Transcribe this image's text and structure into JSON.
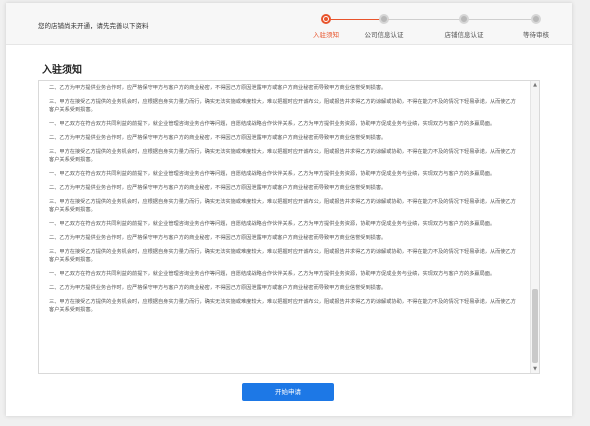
{
  "topbar": {
    "notice": "您的店铺尚未开通，请先完善以下资料"
  },
  "steps": [
    {
      "label": "入驻须知",
      "active": true
    },
    {
      "label": "公司信息认证",
      "active": false
    },
    {
      "label": "店铺信息认证",
      "active": false
    },
    {
      "label": "等待审核",
      "active": false
    }
  ],
  "main": {
    "title": "入驻须知",
    "paragraphs": [
      "二、乙方为甲方提供业务合作时，应严格保守甲方与客户方的商业秘密，不得因己方原因泄露甲方或客户方商业秘密而导致甲方商业信誉受到损害。",
      "三、甲方在接受乙方提供的业务机会时，应根据自身实力量力而行，确实无法实施或难度较大，难以把握时应开诚布公，阻或报告并求得乙方的谅解或协助，不得在能力不及的情况下轻易承诺，从而使乙方客户关系受到损害。",
      "一、甲乙双方在符合双方共同利益的前提下，就企业管理咨询业务合作等问题，自愿结成战略合作伙伴关系，乙方为甲方提供业务资源，协助甲方促成业务与业绩，实现双方与客户方的多赢局面。",
      "二、乙方为甲方提供业务合作时，应严格保守甲方与客户方的商业秘密，不得因己方原因泄露甲方或客户方商业秘密而导致甲方商业信誉受到损害。",
      "三、甲方在接受乙方提供的业务机会时，应根据自身实力量力而行，确实无法实施或难度较大，难以把握时应开诚布公，阻或报告并求得乙方的谅解或协助，不得在能力不及的情况下轻易承诺，从而使乙方客户关系受到损害。",
      "一、甲乙双方在符合双方共同利益的前提下，就企业管理咨询业务合作等问题，自愿结成战略合作伙伴关系，乙方为甲方提供业务资源，协助甲方促成业务与业绩，实现双方与客户方的多赢局面。",
      "二、乙方为甲方提供业务合作时，应严格保守甲方与客户方的商业秘密，不得因己方原因泄露甲方或客户方商业秘密而导致甲方商业信誉受到损害。",
      "三、甲方在接受乙方提供的业务机会时，应根据自身实力量力而行，确实无法实施或难度较大，难以把握时应开诚布公，阻或报告并求得乙方的谅解或协助，不得在能力不及的情况下轻易承诺，从而使乙方客户关系受到损害。",
      "一、甲乙双方在符合双方共同利益的前提下，就企业管理咨询业务合作等问题，自愿结成战略合作伙伴关系，乙方为甲方提供业务资源，协助甲方促成业务与业绩，实现双方与客户方的多赢局面。",
      "二、乙方为甲方提供业务合作时，应严格保守甲方与客户方的商业秘密，不得因己方原因泄露甲方或客户方商业秘密而导致甲方商业信誉受到损害。",
      "三、甲方在接受乙方提供的业务机会时，应根据自身实力量力而行，确实无法实施或难度较大，难以把握时应开诚布公，阻或报告并求得乙方的谅解或协助，不得在能力不及的情况下轻易承诺，从而使乙方客户关系受到损害。",
      "一、甲乙双方在符合双方共同利益的前提下，就企业管理咨询业务合作等问题，自愿结成战略合作伙伴关系，乙方为甲方提供业务资源，协助甲方促成业务与业绩，实现双方与客户方的多赢局面。",
      "二、乙方为甲方提供业务合作时，应严格保守甲方与客户方的商业秘密，不得因己方原因泄露甲方或客户方商业秘密而导致甲方商业信誉受到损害。",
      "三、甲方在接受乙方提供的业务机会时，应根据自身实力量力而行，确实无法实施或难度较大，难以把握时应开诚布公，阻或报告并求得乙方的谅解或协助，不得在能力不及的情况下轻易承诺，从而使乙方客户关系受到损害。"
    ],
    "submit_label": "开始申请"
  },
  "colors": {
    "accent": "#e8542c",
    "primary": "#1d78e6"
  }
}
